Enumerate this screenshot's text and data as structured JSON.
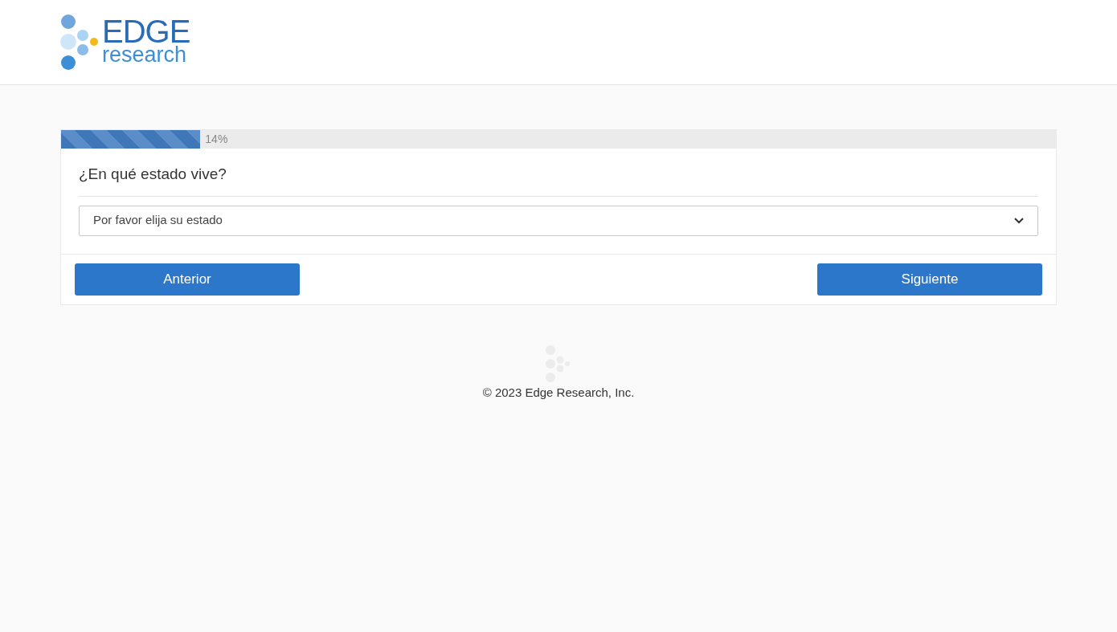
{
  "logo": {
    "brand": "EDGE",
    "tagline": "research"
  },
  "progress": {
    "level": 0.14,
    "reading": "14%"
  },
  "question": {
    "text": "¿En qué estado vive?",
    "select": {
      "placeholder": "Por favor elija su estado"
    }
  },
  "buttons": [
    "Anterior",
    "Siguiente"
  ],
  "footer": {
    "copyright": "© 2023 Edge Research, Inc."
  }
}
